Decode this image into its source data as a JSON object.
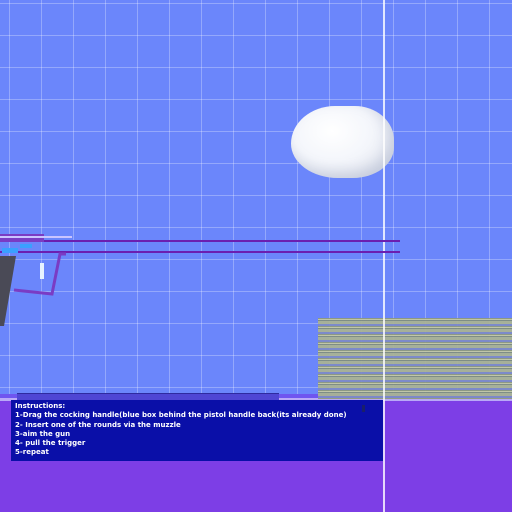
{
  "colors": {
    "sky": "#6b86fb",
    "floor": "#7d3ee6",
    "instruction_panel": "#0a0fa8",
    "gun_outline": "#6b1fb0",
    "cocking_handle": "#3aa0ff"
  },
  "instructions": {
    "title": "Instructions:",
    "steps": [
      "1-Drag the cocking handle(blue box behind the pistol handle back(its already done)",
      "2- Insert one of the rounds via the muzzle",
      "3-aim the gun",
      "4- pull the trigger",
      "5-repeat"
    ]
  }
}
